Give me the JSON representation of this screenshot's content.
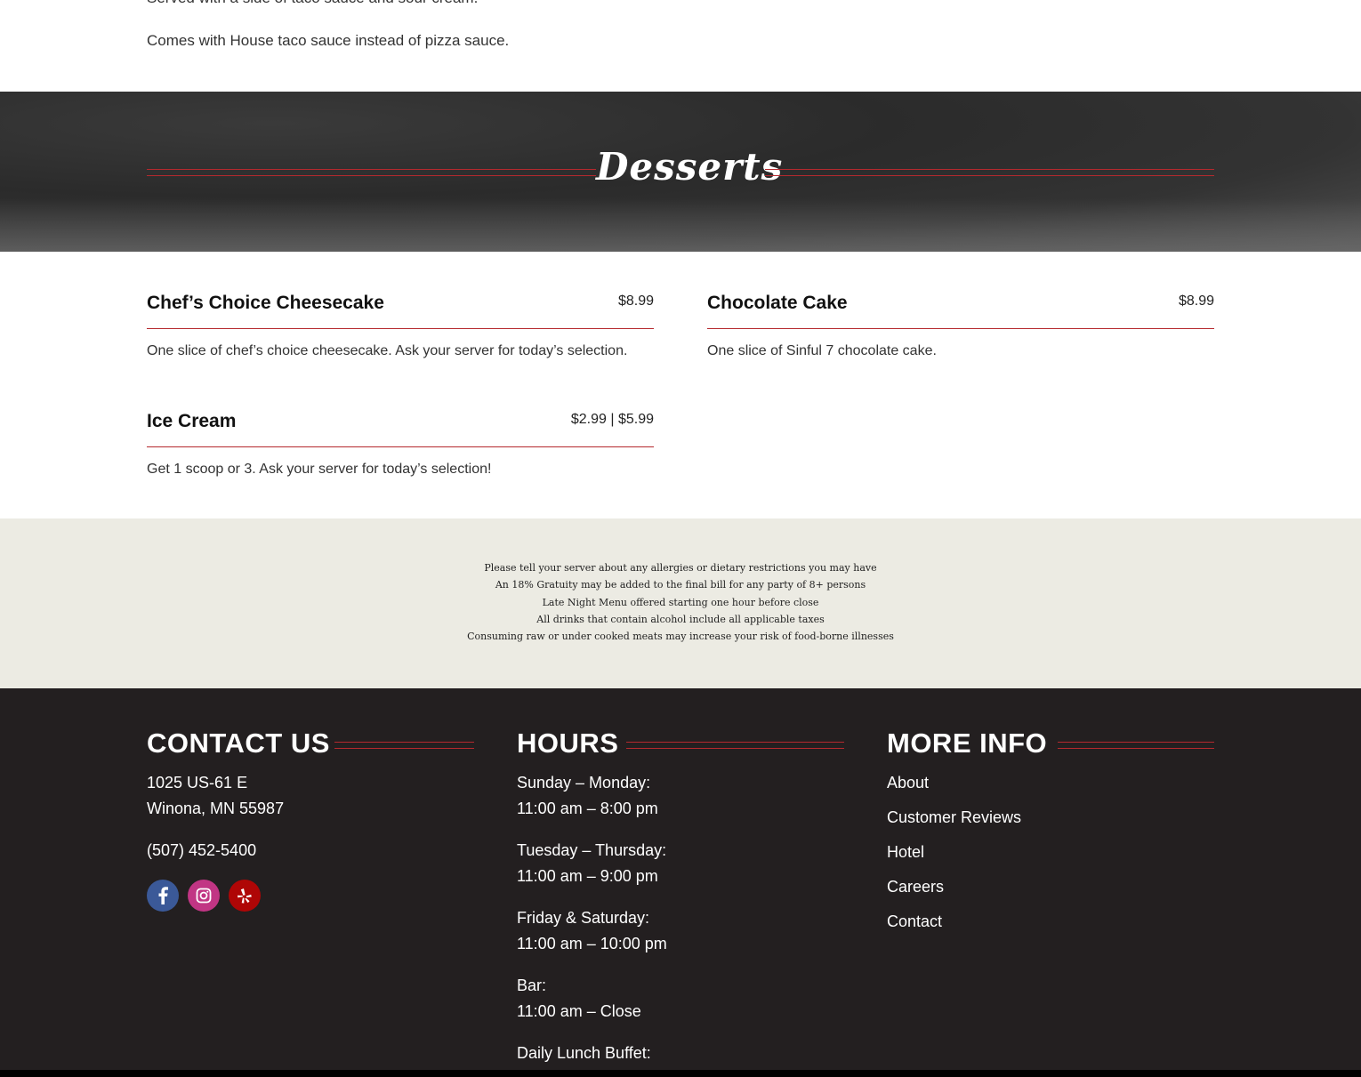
{
  "top": {
    "line1": "Served with a side of taco sauce and sour cream.",
    "line2": "Comes with House taco sauce instead of pizza sauce."
  },
  "banner": {
    "title": "Desserts"
  },
  "menu": {
    "items": [
      {
        "name": "Chef’s Choice Cheesecake",
        "price": "$8.99",
        "desc": "One slice of chef’s choice cheesecake. Ask your server for today’s selection."
      },
      {
        "name": "Chocolate Cake",
        "price": "$8.99",
        "desc": "One slice of Sinful 7 chocolate cake."
      },
      {
        "name": "Ice Cream",
        "price": "$2.99 | $5.99",
        "desc": "Get 1 scoop or 3. Ask your server for today’s selection!"
      }
    ]
  },
  "notes": [
    "Please tell your server about any allergies or dietary restrictions you may have",
    "An 18% Gratuity may be added to the final bill for any party of 8+ persons",
    "Late Night Menu offered starting one hour before close",
    "All drinks that contain alcohol include all applicable taxes",
    "Consuming raw or under cooked meats may increase your risk of food-borne illnesses"
  ],
  "footer": {
    "contact": {
      "title": "CONTACT US",
      "address1": "1025 US-61 E",
      "address2": "Winona, MN 55987",
      "phone": "(507) 452-5400",
      "social": [
        {
          "icon": "facebook-icon",
          "color": "#3b5998"
        },
        {
          "icon": "instagram-icon",
          "color": "#c13584"
        },
        {
          "icon": "yelp-icon",
          "color": "#af0606"
        }
      ]
    },
    "hours": {
      "title": "HOURS",
      "blocks": [
        {
          "label": "Sunday – Monday:",
          "time": "11:00 am – 8:00 pm"
        },
        {
          "label": "Tuesday – Thursday:",
          "time": "11:00 am – 9:00 pm"
        },
        {
          "label": "Friday & Saturday:",
          "time": "11:00 am – 10:00 pm"
        },
        {
          "label": "Bar:",
          "time": "11:00 am – Close"
        },
        {
          "label": "Daily Lunch Buffet:",
          "time": ""
        }
      ]
    },
    "more": {
      "title": "MORE INFO",
      "links": [
        "About",
        "Customer Reviews",
        "Hotel",
        "Careers",
        "Contact"
      ]
    }
  },
  "colors": {
    "accent": "#b5292e",
    "footer_bg": "#231f20",
    "notes_bg": "#ecebe3"
  }
}
